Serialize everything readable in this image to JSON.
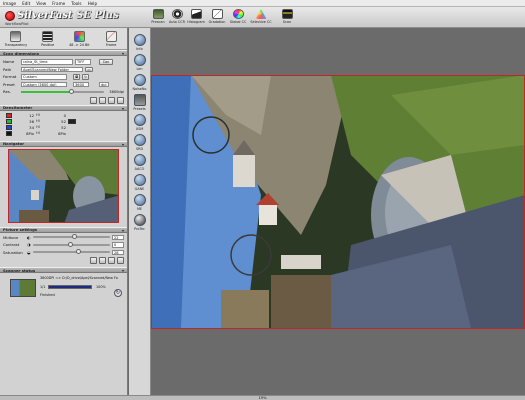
{
  "menu": [
    "Image",
    "Edit",
    "View",
    "Frame",
    "Tools",
    "Help"
  ],
  "app": {
    "logo_name": "SilverFast",
    "logo_edition": "SE Plus",
    "logo_sub": "WorkflowPilot"
  },
  "top_toolbar": [
    {
      "label": "Prescan",
      "icon": "prescan-icon"
    },
    {
      "label": "Auto CCR",
      "icon": "auto-ccr-icon"
    },
    {
      "label": "Histogram",
      "icon": "histogram-icon"
    },
    {
      "label": "Gradation",
      "icon": "gradation-icon"
    },
    {
      "label": "Global CC",
      "icon": "global-cc-icon"
    },
    {
      "label": "Selective CC",
      "icon": "selective-cc-icon"
    },
    {
      "label": "Scan",
      "icon": "scan-icon"
    }
  ],
  "left_toolbar": [
    {
      "label": "Transparency",
      "icon": "transparency-icon"
    },
    {
      "label": "Positive",
      "icon": "film-icon"
    },
    {
      "label": "48 -> 24 Bit",
      "icon": "bit-depth-icon"
    },
    {
      "label": "Frame",
      "icon": "frame-icon"
    }
  ],
  "scan_dimensions": {
    "header": "Scan dimensions",
    "name_label": "Name",
    "name_value": "ralna_St_time",
    "format_value": "TIFF",
    "cancel_label": "Can",
    "path_label": "Path",
    "path_value": "Apel/Scanned/New Folder",
    "format_label": "Format",
    "format_select": "Custom",
    "preset_label": "Preset",
    "preset_select": "Custom (3600 dpi)",
    "preset_value": "3600",
    "preset_unit": "dpi",
    "res_label": "Res.",
    "res_value": "3600dpi"
  },
  "densitometer": {
    "header": "Densitometer",
    "rows": [
      {
        "color": "#e22222",
        "v1": "12",
        "l1": "HI",
        "v2": "0",
        "l2": ""
      },
      {
        "color": "#22bb22",
        "v1": "36",
        "l1": "HI",
        "v2": "52",
        "l2": ""
      },
      {
        "color": "#2244dd",
        "v1": "34",
        "l1": "HI",
        "v2": "52",
        "l2": ""
      },
      {
        "color": "#111111",
        "v1": "8Pix",
        "l1": "HI",
        "v2": "8Pix",
        "l2": ""
      }
    ]
  },
  "navigator": {
    "header": "Navigator"
  },
  "picture_settings": {
    "header": "Picture settings",
    "rows": [
      {
        "label": "Midtone",
        "value": "22",
        "level": 0.55
      },
      {
        "label": "Contrast",
        "value": "0",
        "level": 0.5
      },
      {
        "label": "Saturation",
        "value": "28",
        "level": 0.6
      }
    ]
  },
  "scanner_status": {
    "header": "Scanner status",
    "text": "3600DPI => D:/D_drive/Apel/Scanned/New Fo",
    "count": "1/1",
    "progress_label": "100%",
    "progress": 1.0,
    "state": "Finished"
  },
  "vertical_tools": [
    {
      "label": "Info",
      "icon": "info-icon"
    },
    {
      "label": "Len",
      "icon": "magnifier-icon"
    },
    {
      "label": "NoiseNo",
      "icon": "noise-icon"
    },
    {
      "label": "Presets",
      "icon": "presets-icon"
    },
    {
      "label": "USM",
      "icon": "usm-icon"
    },
    {
      "label": "SRD",
      "icon": "srd-icon"
    },
    {
      "label": "AACO",
      "icon": "aaco-icon"
    },
    {
      "label": "GANE",
      "icon": "gane-icon"
    },
    {
      "label": "ME",
      "icon": "me-icon"
    },
    {
      "label": "ProTec",
      "icon": "protec-icon"
    }
  ],
  "status_bar": {
    "zoom": "19%"
  }
}
